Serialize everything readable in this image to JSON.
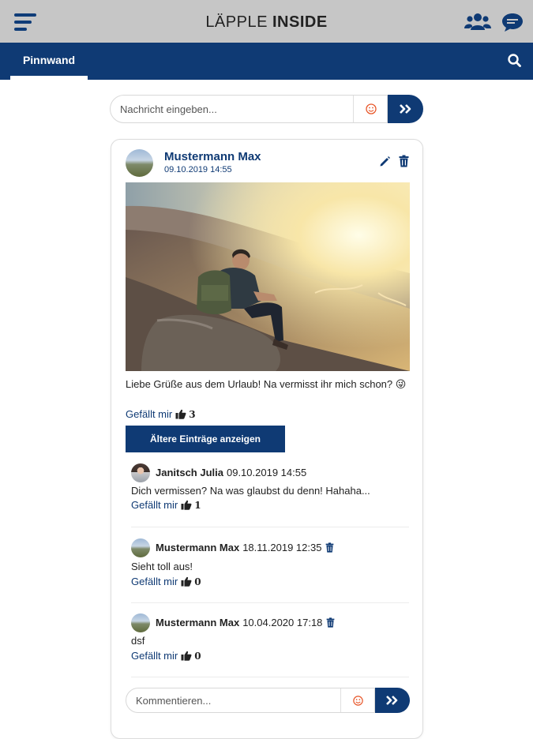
{
  "header": {
    "brand_light": "LÄPPLE ",
    "brand_bold": "INSIDE",
    "menu_icon": "hamburger-menu-icon",
    "users_icon": "users-group-icon",
    "chat_icon": "chat-bubble-icon"
  },
  "nav": {
    "tabs": [
      {
        "label": "Pinnwand",
        "active": true
      }
    ],
    "search_icon": "search-icon"
  },
  "composer": {
    "placeholder": "Nachricht eingeben...",
    "emoji_icon": "emoji-icon",
    "send_icon": "send-double-chevron-icon"
  },
  "post": {
    "author": "Mustermann Max",
    "date": "09.10.2019 14:55",
    "text": "Liebe Grüße aus dem Urlaub! Na vermisst ihr mich schon? 😜",
    "like_label": "Gefällt mir",
    "like_count": "3",
    "older_button": "Ältere Einträge anzeigen",
    "comments": [
      {
        "author": "Janitsch Julia",
        "date": "09.10.2019 14:55",
        "text": "Dich vermissen? Na was glaubst du denn! Hahaha...",
        "like_label": "Gefällt mir",
        "like_count": "1",
        "deletable": false
      },
      {
        "author": "Mustermann Max",
        "date": "18.11.2019 12:35",
        "text": "Sieht toll aus!",
        "like_label": "Gefällt mir",
        "like_count": "0",
        "deletable": true
      },
      {
        "author": "Mustermann Max",
        "date": "10.04.2020 17:18",
        "text": "dsf",
        "like_label": "Gefällt mir",
        "like_count": "0",
        "deletable": true
      }
    ],
    "comment_placeholder": "Kommentieren..."
  },
  "colors": {
    "primary": "#0f3a74",
    "topbar": "#c6c6c6",
    "emoji_accent": "#e8572a"
  }
}
